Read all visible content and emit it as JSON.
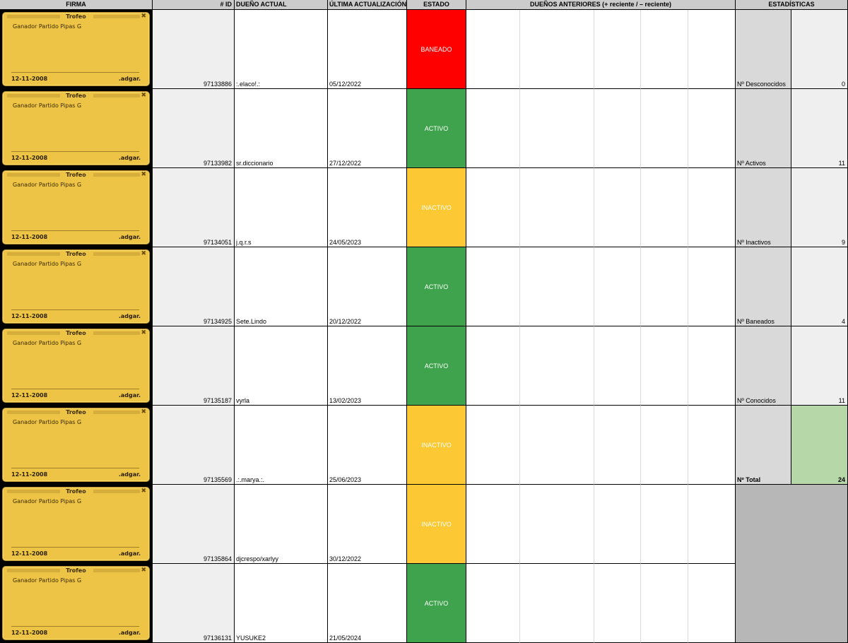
{
  "headers": {
    "firma": "FIRMA",
    "id": "# ID",
    "owner": "DUEÑO ACTUAL",
    "updated": "ÚLTIMA ACTUALIZACIÓN",
    "estado": "ESTADO",
    "previous": "DUEÑOS ANTERIORES (+ reciente / – reciente)",
    "stats": "ESTADÍSTICAS"
  },
  "card": {
    "title": "Trofeo",
    "description": "Ganador Partido Pipas G",
    "date": "12-11-2008",
    "author": ".adgar.",
    "close_icon": "close-icon"
  },
  "rows": [
    {
      "id": "97133886",
      "owner": ":.elaco!.:",
      "updated": "05/12/2022",
      "status": "BANEADO",
      "status_color": "#ff0000"
    },
    {
      "id": "97133982",
      "owner": "sr.diccionario",
      "updated": "27/12/2022",
      "status": "ACTIVO",
      "status_color": "#3fa34d"
    },
    {
      "id": "97134051",
      "owner": "j.q.r.s",
      "updated": "24/05/2023",
      "status": "INACTIVO",
      "status_color": "#fcc934"
    },
    {
      "id": "97134925",
      "owner": "Sete.Lindo",
      "updated": "20/12/2022",
      "status": "ACTIVO",
      "status_color": "#3fa34d"
    },
    {
      "id": "97135187",
      "owner": "vyrla",
      "updated": "13/02/2023",
      "status": "ACTIVO",
      "status_color": "#3fa34d"
    },
    {
      "id": "97135569",
      "owner": ".:.marya.:.",
      "updated": "25/06/2023",
      "status": "INACTIVO",
      "status_color": "#fcc934"
    },
    {
      "id": "97135864",
      "owner": "djcrespo/xarlyy",
      "updated": "30/12/2022",
      "status": "INACTIVO",
      "status_color": "#fcc934"
    },
    {
      "id": "97136131",
      "owner": "YUSUKE2",
      "updated": "21/05/2024",
      "status": "ACTIVO",
      "status_color": "#3fa34d"
    }
  ],
  "stats": [
    {
      "label": "Nº Desconocidos",
      "value": "0"
    },
    {
      "label": "Nº Activos",
      "value": "11"
    },
    {
      "label": "Nº Inactivos",
      "value": "9"
    },
    {
      "label": "Nº Baneados",
      "value": "4"
    },
    {
      "label": "Nº Conocidos",
      "value": "11"
    },
    {
      "label": "Nº Total",
      "value": "24",
      "total": true
    }
  ]
}
